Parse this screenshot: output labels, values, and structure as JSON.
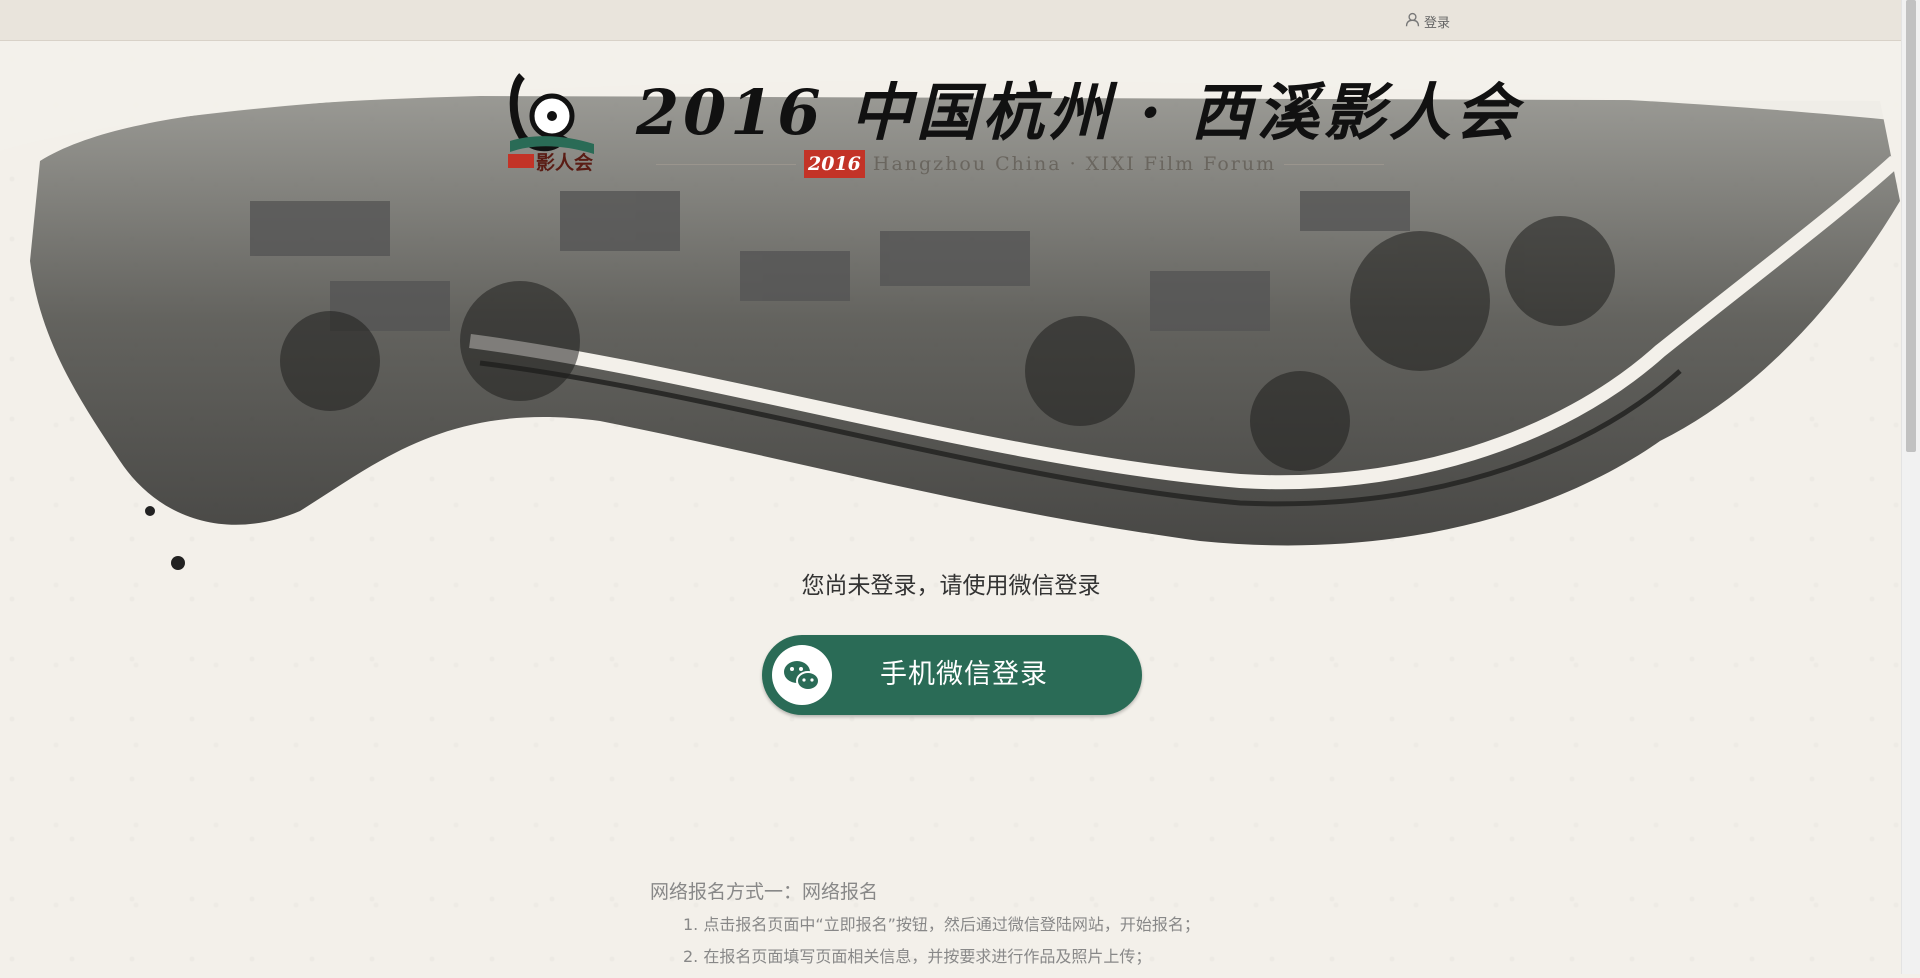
{
  "topbar": {
    "login_label": "登录",
    "login_icon": "user-icon"
  },
  "header": {
    "title": "2016 中国杭州 · 西溪影人会",
    "logo_caption": "影人会",
    "year_stamp": "2016",
    "subtitle_en": "Hangzhou  China · XIXI  Film  Forum"
  },
  "login": {
    "notice": "您尚未登录，请使用微信登录",
    "wechat_button_label": "手机微信登录",
    "wechat_icon": "wechat-icon",
    "button_color": "#2a6b56"
  },
  "registration": {
    "title": "网络报名方式一：网络报名",
    "steps": [
      "1. 点击报名页面中“立即报名”按钮，然后通过微信登陆网站，开始报名；",
      "2. 在报名页面填写页面相关信息，并按要求进行作品及照片上传；"
    ]
  }
}
